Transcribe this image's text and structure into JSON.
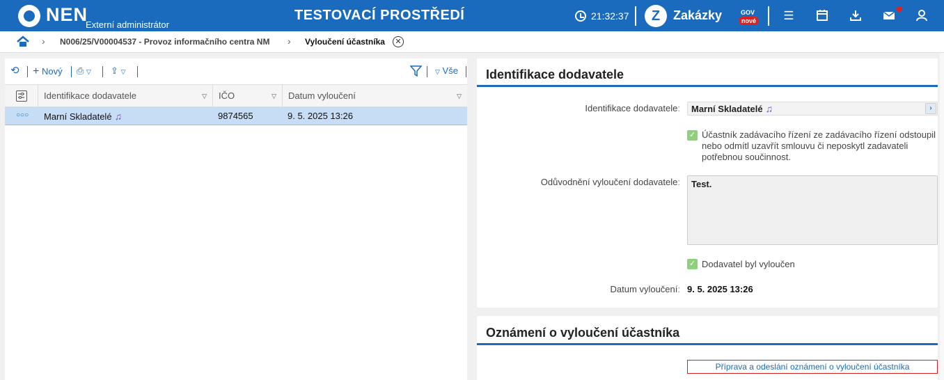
{
  "header": {
    "logo": "NEN",
    "subtitle": "Externí administrátor",
    "env_title": "TESTOVACÍ PROSTŘEDÍ",
    "time": "21:32:37",
    "zakazky": "Zakázky",
    "gov": "GOV",
    "nove": "nové",
    "icons": [
      "menu-icon",
      "calendar-icon",
      "download-icon",
      "mail-icon",
      "user-icon"
    ]
  },
  "breadcrumb": {
    "item1": "N006/25/V00004537 - Provoz informačního centra NM",
    "item2": "Vyloučení účastníka"
  },
  "toolbar": {
    "new_label": "Nový",
    "filter_all": "Vše"
  },
  "grid": {
    "columns": [
      "Identifikace dodavatele",
      "IČO",
      "Datum vyloučení"
    ],
    "rows": [
      {
        "dodavatel": "Marní Skladatelé",
        "ico": "9874565",
        "datum": "9. 5. 2025 13:26"
      }
    ]
  },
  "detail": {
    "section_title": "Identifikace dodavatele",
    "dodavatel_label": "Identifikace dodavatele",
    "dodavatel_value": "Marní Skladatelé",
    "check1_text_l1": "Účastník zadávacího řízení ze zadávacího řízení odstoupil",
    "check1_text_l2": "nebo odmítl uzavřít smlouvu či neposkytl zadavateli",
    "check1_text_l3": "potřebnou součinnost.",
    "oduvodneni_label": "Odůvodnění vyloučení dodavatele",
    "oduvodneni_value": "Test.",
    "check2_text": "Dodavatel byl vyloučen",
    "datum_label": "Datum vyloučení",
    "datum_value": "9. 5. 2025 13:26"
  },
  "notice": {
    "section_title": "Oznámení o vyloučení účastníka",
    "link_label": "Příprava a odeslání oznámení o vyloučení účastníka"
  },
  "colors": {
    "brand": "#1a6bbd",
    "selected_row": "#c7dcf5",
    "checkbox": "#8fd07c",
    "badge": "#e02020"
  }
}
